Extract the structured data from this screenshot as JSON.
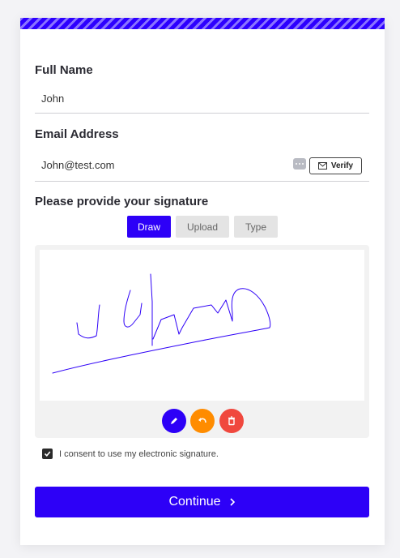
{
  "form": {
    "full_name_label": "Full Name",
    "full_name_value": "John",
    "email_label": "Email Address",
    "email_value": "John@test.com",
    "verify_label": "Verify",
    "signature_label": "Please provide your signature",
    "tabs": [
      {
        "label": "Draw",
        "active": true
      },
      {
        "label": "Upload",
        "active": false
      },
      {
        "label": "Type",
        "active": false
      }
    ],
    "tools": [
      "pen-icon",
      "undo-icon",
      "trash-icon"
    ],
    "consent_label": "I consent to use my electronic signature.",
    "consent_checked": true,
    "continue_label": "Continue"
  },
  "colors": {
    "accent": "#2d00f7",
    "pen_tool": "#2d00f7",
    "undo_tool": "#ff8c00",
    "delete_tool": "#f0483e",
    "signature_ink": "#2d00f7"
  }
}
